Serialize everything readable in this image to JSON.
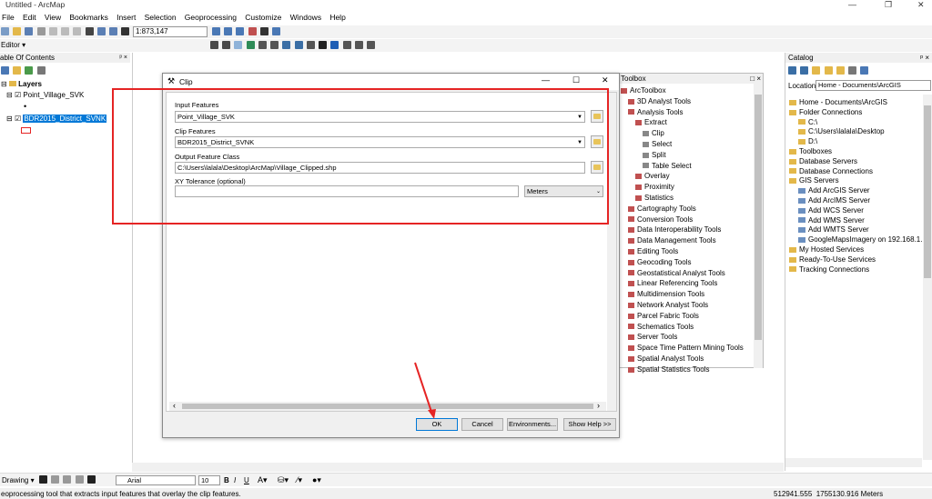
{
  "window": {
    "title": "Untitled - ArcMap",
    "min": "—",
    "max": "❐",
    "close": "✕"
  },
  "menu": [
    "File",
    "Edit",
    "View",
    "Bookmarks",
    "Insert",
    "Selection",
    "Geoprocessing",
    "Customize",
    "Windows",
    "Help"
  ],
  "toolbar": {
    "scale": "1:873,147",
    "editor": "Editor ▾"
  },
  "toc": {
    "title": "able Of Contents",
    "pin": "ⅹ ×",
    "layers_label": "Layers",
    "layer1": "Point_Village_SVK",
    "layer2": "BDR2015_District_SVNK"
  },
  "toolbox": {
    "title": "Toolbox",
    "items": [
      "ArcToolbox",
      "3D Analyst Tools",
      "Analysis Tools",
      "Extract",
      "Clip",
      "Select",
      "Split",
      "Table Select",
      "Overlay",
      "Proximity",
      "Statistics",
      "Cartography Tools",
      "Conversion Tools",
      "Data Interoperability Tools",
      "Data Management Tools",
      "Editing Tools",
      "Geocoding Tools",
      "Geostatistical Analyst Tools",
      "Linear Referencing Tools",
      "Multidimension Tools",
      "Network Analyst Tools",
      "Parcel Fabric Tools",
      "Schematics Tools",
      "Server Tools",
      "Space Time Pattern Mining Tools",
      "Spatial Analyst Tools",
      "Spatial Statistics Tools"
    ]
  },
  "catalog": {
    "title": "Catalog",
    "location_label": "Location:",
    "location_value": "Home - Documents\\ArcGIS",
    "items": [
      "Home - Documents\\ArcGIS",
      "Folder Connections",
      "C:\\",
      "C:\\Users\\lalala\\Desktop",
      "D:\\",
      "Toolboxes",
      "Database Servers",
      "Database Connections",
      "GIS Servers",
      "Add ArcGIS Server",
      "Add ArcIMS Server",
      "Add WCS Server",
      "Add WMS Server",
      "Add WMTS Server",
      "GoogleMapsImagery on 192.168.1.",
      "My Hosted Services",
      "Ready-To-Use Services",
      "Tracking Connections"
    ]
  },
  "dialog": {
    "title": "Clip",
    "input_label": "Input Features",
    "input_value": "Point_Village_SVK",
    "clip_label": "Clip Features",
    "clip_value": "BDR2015_District_SVNK",
    "output_label": "Output Feature Class",
    "output_value": "C:\\Users\\lalala\\Desktop\\ArcMap\\Village_Clipped.shp",
    "xy_label": "XY Tolerance (optional)",
    "xy_value": "",
    "unit": "Meters",
    "ok": "OK",
    "cancel": "Cancel",
    "env": "Environments...",
    "help": "Show Help >>"
  },
  "drawing": {
    "label": "Drawing ▾",
    "font": "Arial",
    "size": "10",
    "bold": "B",
    "italic": "I",
    "underline": "U"
  },
  "status": {
    "message": "eoprocessing tool that extracts input features that overlay the clip features.",
    "coords": "512941.555  1755130.916 Meters"
  },
  "colors": {
    "highlight_red": "#e52424",
    "selection_blue": "#0078d7"
  }
}
